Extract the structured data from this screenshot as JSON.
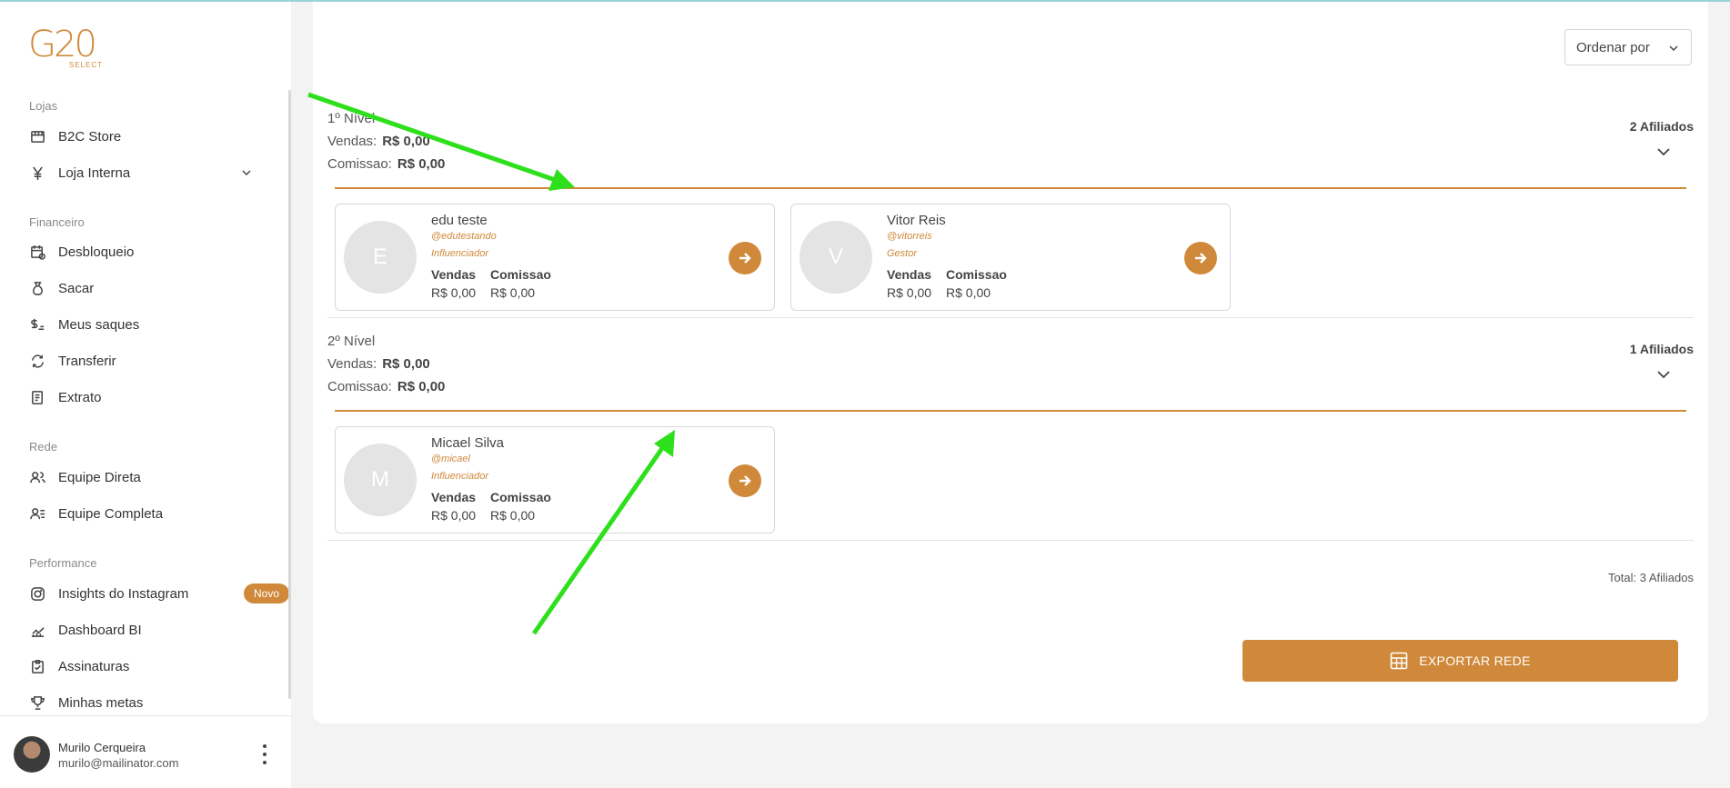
{
  "brand": {
    "logo_main": "G20",
    "logo_sub": "SELECT"
  },
  "sidebar": {
    "sections": [
      {
        "title": "Lojas",
        "items": [
          {
            "label": "B2C Store",
            "icon": "store-icon"
          },
          {
            "label": "Loja Interna",
            "icon": "yen-icon",
            "expandable": true
          }
        ]
      },
      {
        "title": "Financeiro",
        "items": [
          {
            "label": "Desbloqueio",
            "icon": "calendar-clock-icon"
          },
          {
            "label": "Sacar",
            "icon": "money-bag-icon"
          },
          {
            "label": "Meus saques",
            "icon": "cash-list-icon"
          },
          {
            "label": "Transferir",
            "icon": "transfer-icon"
          },
          {
            "label": "Extrato",
            "icon": "receipt-icon"
          }
        ]
      },
      {
        "title": "Rede",
        "items": [
          {
            "label": "Equipe Direta",
            "icon": "users-icon"
          },
          {
            "label": "Equipe Completa",
            "icon": "users-list-icon"
          }
        ]
      },
      {
        "title": "Performance",
        "items": [
          {
            "label": "Insights do Instagram",
            "icon": "instagram-icon",
            "badge": "Novo"
          },
          {
            "label": "Dashboard BI",
            "icon": "chart-icon"
          },
          {
            "label": "Assinaturas",
            "icon": "clipboard-check-icon"
          },
          {
            "label": "Minhas metas",
            "icon": "trophy-icon"
          }
        ]
      }
    ]
  },
  "user": {
    "name": "Murilo Cerqueira",
    "email": "murilo@mailinator.com"
  },
  "main": {
    "order_label": "Ordenar por",
    "levels": [
      {
        "title": "1º Nível",
        "sales_label": "Vendas:",
        "sales_value": "R$ 0,00",
        "commission_label": "Comissao:",
        "commission_value": "R$ 0,00",
        "count": "2 Afiliados",
        "members": [
          {
            "initial": "E",
            "name": "edu teste",
            "handle": "@edutestando",
            "role": "Influenciador",
            "sales_label": "Vendas",
            "commission_label": "Comissao",
            "sales": "R$ 0,00",
            "commission": "R$ 0,00"
          },
          {
            "initial": "V",
            "name": "Vitor Reis",
            "handle": "@vitorreis",
            "role": "Gestor",
            "sales_label": "Vendas",
            "commission_label": "Comissao",
            "sales": "R$ 0,00",
            "commission": "R$ 0,00"
          }
        ]
      },
      {
        "title": "2º Nível",
        "sales_label": "Vendas:",
        "sales_value": "R$ 0,00",
        "commission_label": "Comissao:",
        "commission_value": "R$ 0,00",
        "count": "1 Afiliados",
        "members": [
          {
            "initial": "M",
            "name": "Micael Silva",
            "handle": "@micael",
            "role": "Influenciador",
            "sales_label": "Vendas",
            "commission_label": "Comissao",
            "sales": "R$ 0,00",
            "commission": "R$ 0,00"
          }
        ]
      }
    ],
    "total": "Total: 3 Afiliados",
    "export_label": "EXPORTAR REDE"
  },
  "colors": {
    "accent": "#d0893a",
    "annotation_arrow": "#2ee01c"
  }
}
